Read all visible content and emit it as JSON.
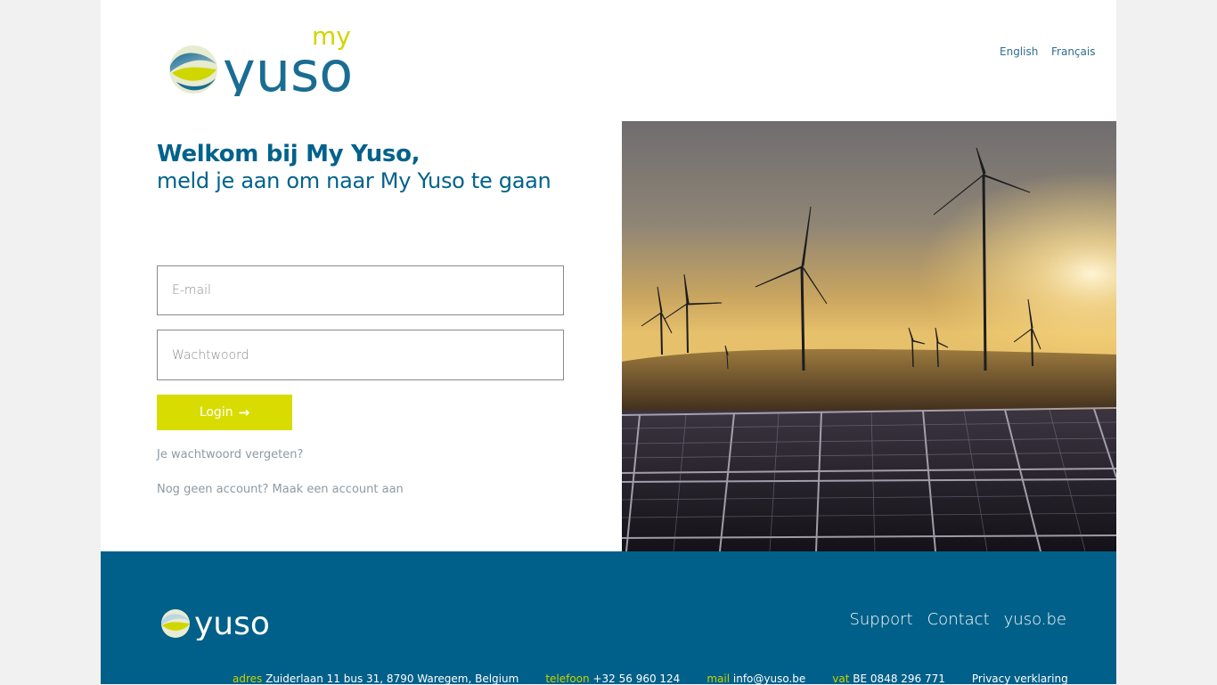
{
  "header": {
    "logo_prefix": "my",
    "logo_text": "yuso",
    "languages": [
      "English",
      "Français"
    ]
  },
  "welcome": {
    "title": "Welkom bij My Yuso,",
    "subtitle": "meld je aan om naar My Yuso te gaan"
  },
  "form": {
    "email_placeholder": "E-mail",
    "password_placeholder": "Wachtwoord",
    "login_label": "Login",
    "login_icon": "arrow-right-icon",
    "forgot_link": "Je wachtwoord vergeten?",
    "signup_link": "Nog geen account? Maak een account aan"
  },
  "footer": {
    "logo_text": "yuso",
    "nav": [
      "Support",
      "Contact",
      "yuso.be"
    ],
    "info": {
      "address_label": "adres",
      "address_value": "Zuiderlaan 11 bus 31, 8790 Waregem, Belgium",
      "phone_label": "telefoon",
      "phone_value": "+32 56 960 124",
      "mail_label": "mail",
      "mail_value": "info@yuso.be",
      "vat_label": "vat",
      "vat_value": "BE 0848 296 771",
      "privacy": "Privacy verklaring"
    }
  },
  "colors": {
    "primary": "#00628b",
    "accent": "#d9dc00",
    "footer_bg": "#006089"
  }
}
